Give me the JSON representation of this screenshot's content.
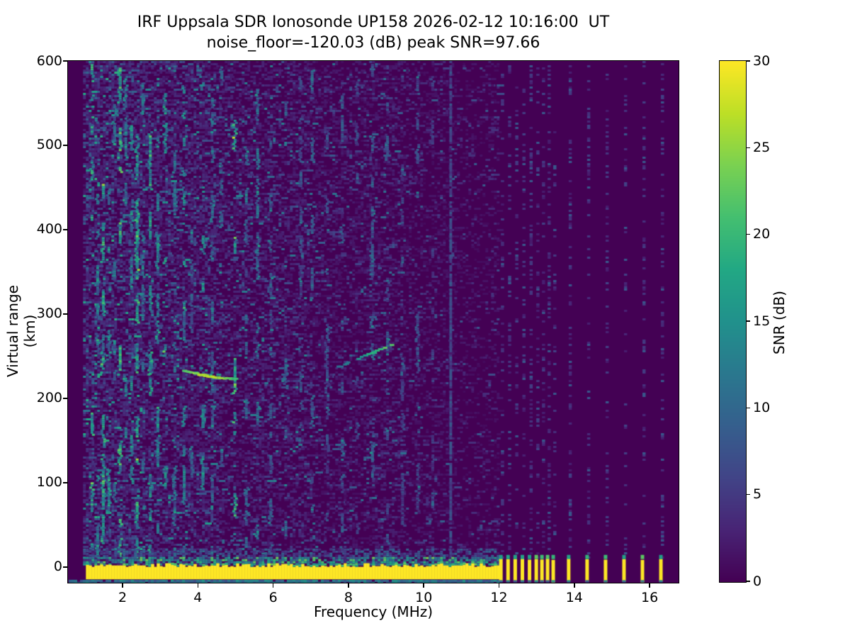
{
  "figure": {
    "background": "#ffffff",
    "text_color": "#000000"
  },
  "chart_data": {
    "type": "heatmap",
    "title": "IRF Uppsala SDR Ionosonde UP158 2026-02-12 10:16:00  UT",
    "subtitle": "noise_floor=-120.03 (dB) peak SNR=97.66",
    "station": "UP158",
    "timestamp_ut": "2026-02-12 10:16:00",
    "noise_floor_db": -120.03,
    "peak_snr_db": 97.66,
    "xlabel": "Frequency (MHz)",
    "ylabel": "Virtual range (km)",
    "xlim": [
      0.55,
      16.77
    ],
    "ylim": [
      -18.5,
      600
    ],
    "xticks": [
      2,
      4,
      6,
      8,
      10,
      12,
      14,
      16
    ],
    "yticks": [
      0,
      100,
      200,
      300,
      400,
      500,
      600
    ],
    "grid": false,
    "colorbar": {
      "label": "SNR (dB)",
      "min": 0,
      "max": 30,
      "ticks": [
        0,
        5,
        10,
        15,
        20,
        25,
        30
      ],
      "colormap": "viridis",
      "position": "right"
    },
    "viridis_stops": [
      [
        0.0,
        "#440154"
      ],
      [
        0.1,
        "#482475"
      ],
      [
        0.2,
        "#414487"
      ],
      [
        0.3,
        "#355f8d"
      ],
      [
        0.4,
        "#2a788e"
      ],
      [
        0.5,
        "#21918c"
      ],
      [
        0.6,
        "#22a884"
      ],
      [
        0.7,
        "#44bf70"
      ],
      [
        0.8,
        "#7ad151"
      ],
      [
        0.9,
        "#bddf26"
      ],
      [
        1.0,
        "#fde725"
      ]
    ],
    "render": {
      "seed": 20260212,
      "background_snr": 0,
      "sweep": {
        "freq_start": 0.95,
        "freq_continuous_end": 11.95,
        "freq_max": 16.35
      },
      "noise_bands": [
        {
          "f0": 0.95,
          "f1": 2.6,
          "p": 0.62,
          "amp": 1.0
        },
        {
          "f0": 2.6,
          "f1": 4.6,
          "p": 0.55,
          "amp": 0.85
        },
        {
          "f0": 4.6,
          "f1": 7.0,
          "p": 0.45,
          "amp": 0.72
        },
        {
          "f0": 7.0,
          "f1": 9.5,
          "p": 0.38,
          "amp": 0.6
        },
        {
          "f0": 9.5,
          "f1": 10.8,
          "p": 0.3,
          "amp": 0.5
        },
        {
          "f0": 10.8,
          "f1": 11.95,
          "p": 0.22,
          "amp": 0.45
        }
      ],
      "rfi_columns": [
        {
          "freq": 1.15,
          "strength": 0.9
        },
        {
          "freq": 1.3,
          "strength": 0.7
        },
        {
          "freq": 1.45,
          "strength": 0.95
        },
        {
          "freq": 1.6,
          "strength": 0.8
        },
        {
          "freq": 1.75,
          "strength": 0.6
        },
        {
          "freq": 1.9,
          "strength": 1.0
        },
        {
          "freq": 2.05,
          "strength": 0.7
        },
        {
          "freq": 2.2,
          "strength": 0.8
        },
        {
          "freq": 2.35,
          "strength": 0.9
        },
        {
          "freq": 2.5,
          "strength": 0.6
        },
        {
          "freq": 2.7,
          "strength": 0.85
        },
        {
          "freq": 2.9,
          "strength": 0.7
        },
        {
          "freq": 3.1,
          "strength": 0.8
        },
        {
          "freq": 3.35,
          "strength": 0.6
        },
        {
          "freq": 3.6,
          "strength": 0.7
        },
        {
          "freq": 3.8,
          "strength": 0.5
        },
        {
          "freq": 4.1,
          "strength": 0.75
        },
        {
          "freq": 4.35,
          "strength": 0.6
        },
        {
          "freq": 4.6,
          "strength": 0.5
        },
        {
          "freq": 4.95,
          "strength": 0.95
        },
        {
          "freq": 5.25,
          "strength": 0.5
        },
        {
          "freq": 5.55,
          "strength": 0.6
        },
        {
          "freq": 5.9,
          "strength": 0.45
        },
        {
          "freq": 6.3,
          "strength": 0.5
        },
        {
          "freq": 6.7,
          "strength": 0.4
        },
        {
          "freq": 7.0,
          "strength": 0.55
        },
        {
          "freq": 7.4,
          "strength": 0.4
        },
        {
          "freq": 7.8,
          "strength": 0.45
        },
        {
          "freq": 8.2,
          "strength": 0.4
        },
        {
          "freq": 8.6,
          "strength": 0.5
        },
        {
          "freq": 9.0,
          "strength": 0.4
        },
        {
          "freq": 9.4,
          "strength": 0.35
        },
        {
          "freq": 9.8,
          "strength": 0.4
        },
        {
          "freq": 10.2,
          "strength": 0.3
        }
      ],
      "persistent_carrier": {
        "freq": 10.68,
        "snr_db": 6
      },
      "echo_traces": [
        {
          "name": "E-region echo",
          "f0": 3.62,
          "r0_km": 234,
          "f1": 4.98,
          "r1_km": 224.5,
          "curve_km": -1.5,
          "fill": 0.95,
          "snr_base_db": 16,
          "snr_peak_db": 25
        },
        {
          "name": "F-region echo",
          "f0": 7.72,
          "r0_km": 239,
          "f1": 9.22,
          "r1_km": 267,
          "curve_km": 0,
          "fill": 0.55,
          "snr_base_db": 9,
          "snr_peak_db": 22
        }
      ],
      "ground_band": {
        "yellow_top_km": 2,
        "yellow_bottom_km": -14.5,
        "snr_db": 30,
        "fringe_top_km": 12,
        "halo_top_km": 22,
        "underline_top_km": -15,
        "underline_bottom_km": -17.8
      },
      "pulse_freqs": [
        12.05,
        12.24,
        12.43,
        12.62,
        12.81,
        12.99,
        13.14,
        13.29,
        13.44,
        13.85,
        14.34,
        14.83,
        15.32,
        15.81,
        16.3
      ],
      "pulse_band": {
        "top_km": 9.5,
        "tip_km": 14.5,
        "bottom_km": -15.5,
        "speckle_p": 0.24
      }
    }
  }
}
